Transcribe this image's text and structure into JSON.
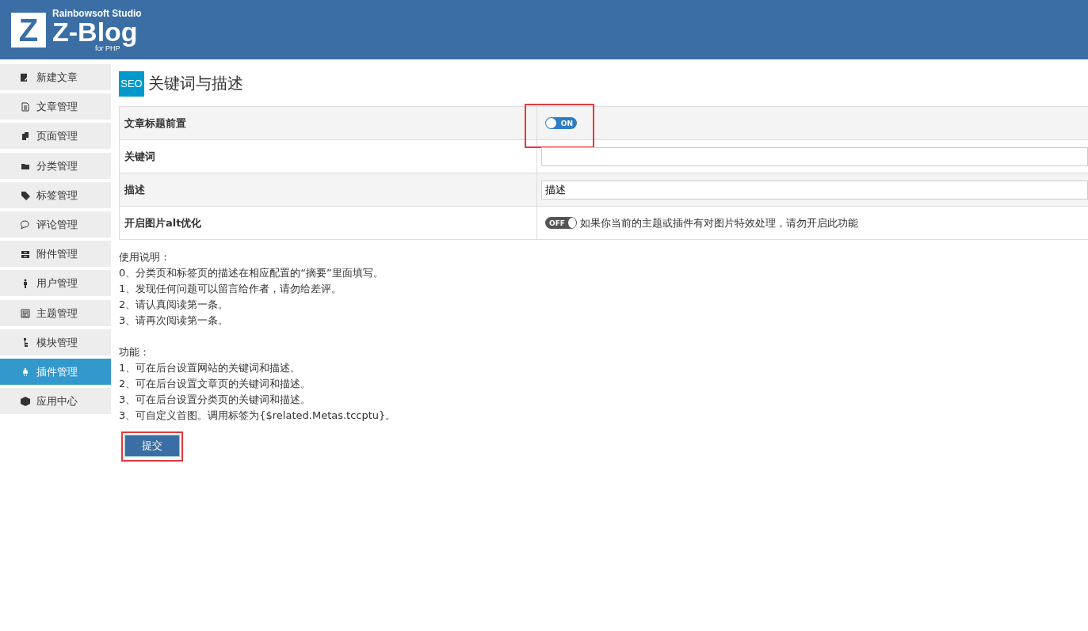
{
  "header": {
    "studio": "Rainbowsoft Studio",
    "logo_mark": "Z",
    "logo_text": "Z-Blog",
    "logo_sub": "for PHP"
  },
  "sidebar": {
    "groups": [
      [
        {
          "label": "新建文章",
          "selected": false
        },
        {
          "label": "文章管理",
          "selected": false
        },
        {
          "label": "页面管理",
          "selected": false
        }
      ],
      [
        {
          "label": "分类管理",
          "selected": false
        },
        {
          "label": "标签管理",
          "selected": false
        },
        {
          "label": "评论管理",
          "selected": false
        },
        {
          "label": "附件管理",
          "selected": false
        },
        {
          "label": "用户管理",
          "selected": false
        }
      ],
      [
        {
          "label": "主题管理",
          "selected": false
        },
        {
          "label": "模块管理",
          "selected": false
        },
        {
          "label": "插件管理",
          "selected": true
        },
        {
          "label": "应用中心",
          "selected": false
        }
      ]
    ]
  },
  "page": {
    "badge": "SEO",
    "title": "关键词与描述"
  },
  "settings": [
    {
      "kind": "toggle",
      "label": "文章标题前置",
      "on": true,
      "toggle_text": "ON",
      "highlighted": true
    },
    {
      "kind": "input",
      "label": "关键词"
    },
    {
      "kind": "input",
      "label": "描述",
      "value": "描述"
    },
    {
      "kind": "toggle",
      "label": "开启图片alt优化",
      "on": false,
      "toggle_text": "OFF",
      "note": "如果你当前的主题或插件有对图片特效处理，请勿开启此功能",
      "highlighted": false
    }
  ],
  "notes": [
    [
      "使用说明：",
      "0、分类页和标签页的描述在相应配置的“摘要”里面填写。",
      "1、发现任何问题可以留言给作者，请勿给差评。",
      "2、请认真阅读第一条。",
      "3、请再次阅读第一条。"
    ],
    [
      "功能：",
      "1、可在后台设置网站的关键词和描述。",
      "2、可在后台设置文章页的关键词和描述。",
      "3、可在后台设置分类页的关键词和描述。",
      "3、可自定义首图。调用标签为{$related.Metas.tccptu}。"
    ]
  ],
  "submit": {
    "label": "提交",
    "highlighted": true
  }
}
